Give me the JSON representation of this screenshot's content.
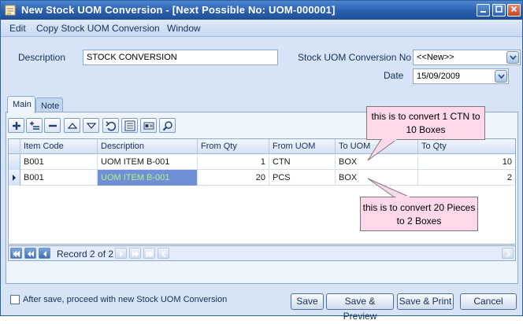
{
  "window": {
    "title": "New Stock UOM Conversion - [Next Possible No: UOM-000001]"
  },
  "menu": [
    "Edit",
    "Copy Stock UOM Conversion",
    "Window"
  ],
  "header": {
    "description_label": "Description",
    "description_value": "STOCK CONVERSION",
    "conversion_no_label": "Stock UOM Conversion No",
    "conversion_no_value": "<<New>>",
    "date_label": "Date",
    "date_value": "15/09/2009"
  },
  "tabs": [
    "Main",
    "Note"
  ],
  "toolbar_icons": [
    "add-row-icon",
    "insert-row-icon",
    "delete-row-icon",
    "move-up-icon",
    "move-down-icon",
    "undo-icon",
    "list-icon",
    "detail-icon",
    "search-icon"
  ],
  "grid": {
    "columns": [
      "Item Code",
      "Description",
      "From Qty",
      "From UOM",
      "To UOM",
      "To Qty"
    ],
    "rows": [
      {
        "item_code": "B001",
        "description": "UOM ITEM B-001",
        "from_qty": "1",
        "from_uom": "CTN",
        "to_uom": "BOX",
        "to_qty": "10"
      },
      {
        "item_code": "B001",
        "description": "UOM ITEM B-001",
        "from_qty": "20",
        "from_uom": "PCS",
        "to_uom": "BOX",
        "to_qty": "2"
      }
    ]
  },
  "navigator": {
    "record_text": "Record 2 of 2"
  },
  "callouts": {
    "first": "this is to convert 1 CTN to 10 Boxes",
    "second": "this is to convert 20 Pieces to 2 Boxes"
  },
  "footer": {
    "proceed_label": "After save, proceed with new Stock UOM Conversion",
    "proceed_checked": false,
    "buttons": {
      "save": "Save",
      "save_preview": "Save & Preview",
      "save_print": "Save & Print",
      "cancel": "Cancel"
    }
  },
  "colors": {
    "accent": "#2a5fae",
    "callout": "#fdd8ea",
    "selected_cell": "#6f8fd6",
    "panel": "#d6e4f5"
  }
}
